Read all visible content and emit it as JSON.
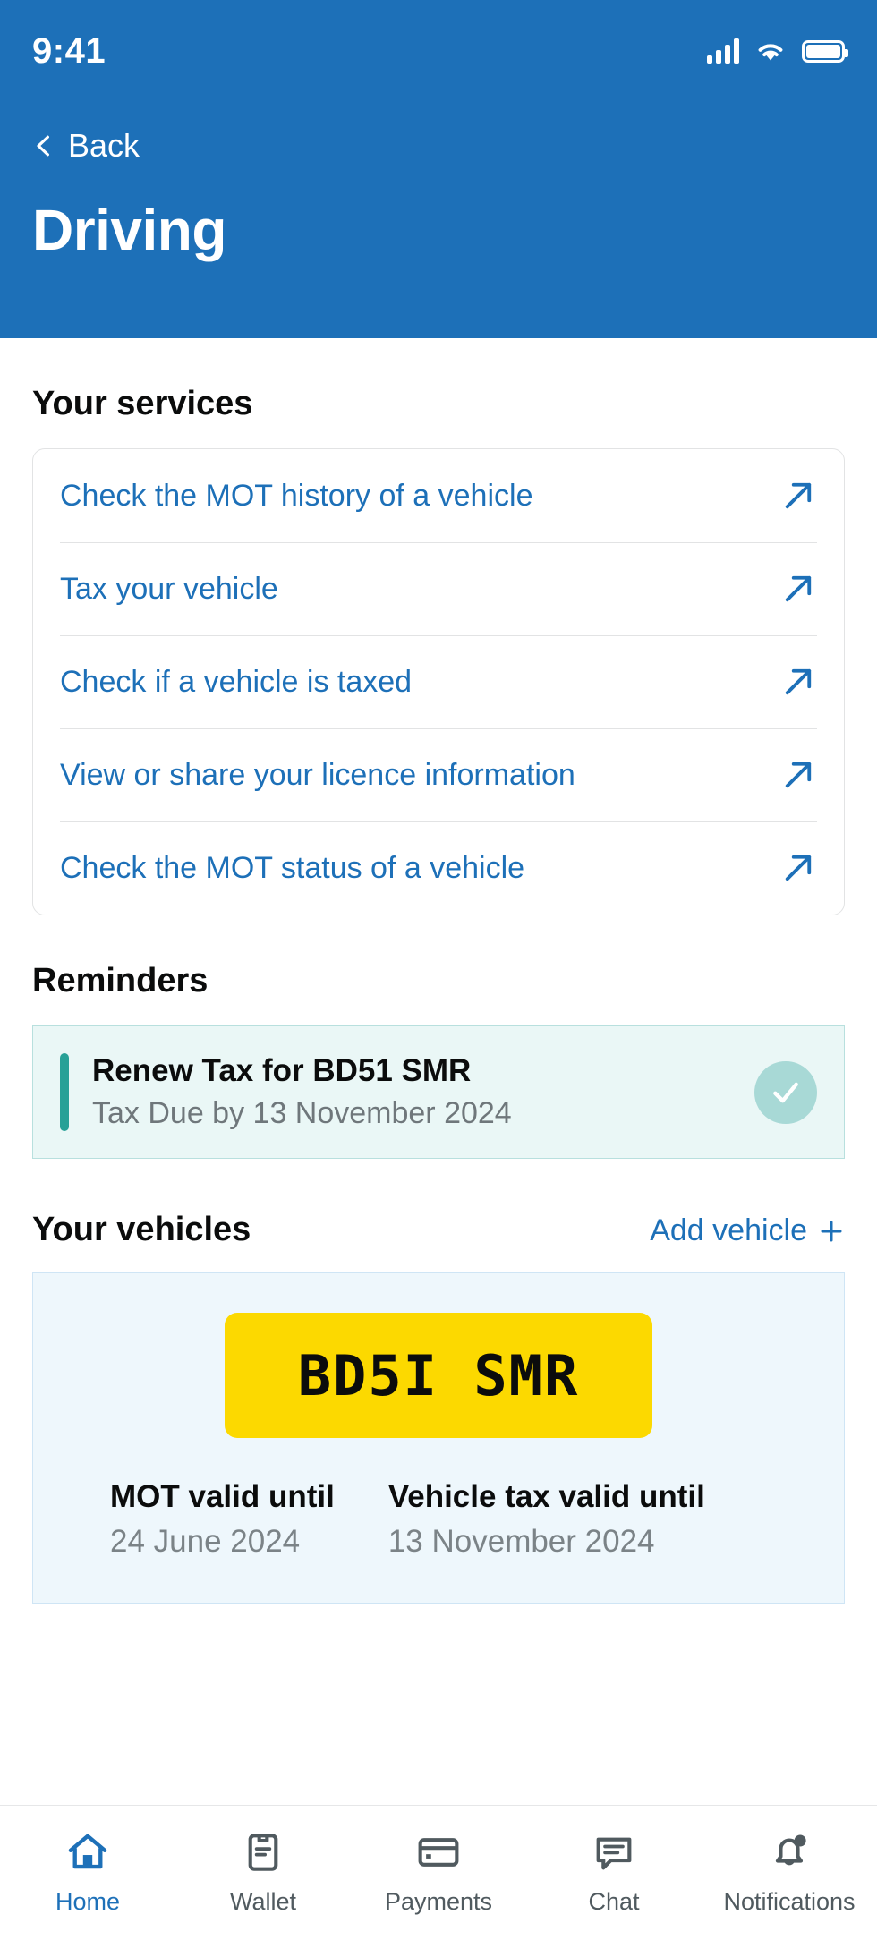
{
  "statusbar": {
    "time": "9:41",
    "signal_icon": "cellular-signal-icon",
    "wifi_icon": "wifi-icon",
    "battery_icon": "battery-icon"
  },
  "header": {
    "back_label": "Back",
    "title": "Driving",
    "background_color": "#1d70b8"
  },
  "services": {
    "heading": "Your services",
    "items": [
      {
        "label": "Check the MOT history of a vehicle",
        "icon": "external-link-arrow-icon"
      },
      {
        "label": "Tax your vehicle",
        "icon": "external-link-arrow-icon"
      },
      {
        "label": "Check if a vehicle is taxed",
        "icon": "external-link-arrow-icon"
      },
      {
        "label": "View or share your licence information",
        "icon": "external-link-arrow-icon"
      },
      {
        "label": "Check the MOT status of a vehicle",
        "icon": "external-link-arrow-icon"
      }
    ],
    "link_color": "#1d70b8"
  },
  "reminders": {
    "heading": "Reminders",
    "item": {
      "title": "Renew Tax for BD51 SMR",
      "subtitle": "Tax Due by 13 November 2024",
      "status_icon": "check-circle-icon",
      "accent_color": "#28a197",
      "background_color": "#eaf7f6"
    }
  },
  "vehicles": {
    "heading": "Your vehicles",
    "add_label": "Add vehicle",
    "add_icon": "plus-icon",
    "card": {
      "plate": "BD5I SMR",
      "plate_color": "#fcd900",
      "mot_label": "MOT valid until",
      "mot_date": "24 June 2024",
      "tax_label": "Vehicle tax valid until",
      "tax_date": "13 November 2024",
      "background_color": "#eef7fc"
    }
  },
  "tabbar": {
    "active_color": "#1d70b8",
    "inactive_color": "#505a5f",
    "items": [
      {
        "label": "Home",
        "icon": "home-icon",
        "active": true
      },
      {
        "label": "Wallet",
        "icon": "wallet-clipboard-icon",
        "active": false
      },
      {
        "label": "Payments",
        "icon": "credit-card-icon",
        "active": false
      },
      {
        "label": "Chat",
        "icon": "chat-bubble-icon",
        "active": false
      },
      {
        "label": "Notifications",
        "icon": "bell-badge-icon",
        "active": false
      }
    ]
  }
}
